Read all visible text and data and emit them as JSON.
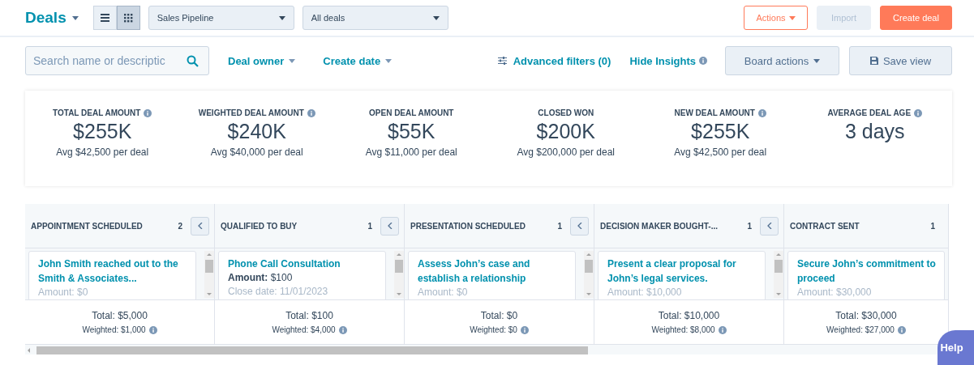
{
  "header": {
    "title": "Deals",
    "views": [
      {
        "kind": "list",
        "selected": false
      },
      {
        "kind": "grid",
        "selected": true
      }
    ],
    "pipeline": "Sales Pipeline",
    "filter": "All deals",
    "actions": "Actions",
    "import": {
      "label": "Import",
      "disabled": true
    },
    "create": "Create deal"
  },
  "filters": {
    "search_placeholder": "Search name or descriptic",
    "deal_owner": "Deal owner",
    "create_date": "Create date",
    "advanced": "Advanced filters (0)",
    "insights": "Hide Insights",
    "board_actions": "Board actions",
    "save_view": "Save view"
  },
  "metrics": [
    {
      "label": "TOTAL DEAL AMOUNT",
      "info": true,
      "value": "$255K",
      "sub": "Avg $42,500 per deal"
    },
    {
      "label": "WEIGHTED DEAL AMOUNT",
      "info": true,
      "value": "$240K",
      "sub": "Avg $40,000 per deal"
    },
    {
      "label": "OPEN DEAL AMOUNT",
      "info": false,
      "value": "$55K",
      "sub": "Avg $11,000 per deal"
    },
    {
      "label": "CLOSED WON",
      "info": false,
      "value": "$200K",
      "sub": "Avg $200,000 per deal"
    },
    {
      "label": "NEW DEAL AMOUNT",
      "info": true,
      "value": "$255K",
      "sub": "Avg $42,500 per deal"
    },
    {
      "label": "AVERAGE DEAL AGE",
      "info": true,
      "value": "3 days"
    }
  ],
  "stages": [
    {
      "name": "APPOINTMENT SCHEDULED",
      "count": "2",
      "collapse": true,
      "card": {
        "title": "John Smith reached out to the Smith & Associates...",
        "lines": [
          {
            "text": "Amount: $0",
            "faded": true
          }
        ]
      },
      "total": "Total: $5,000",
      "weighted": "Weighted: $1,000"
    },
    {
      "name": "QUALIFIED TO BUY",
      "count": "1",
      "collapse": true,
      "card": {
        "title": "Phone Call Consultation",
        "lines": [
          {
            "text": "**Amount:** $100",
            "faded": false
          },
          {
            "text": "Close date: 11/01/2023",
            "faded": true
          }
        ]
      },
      "total": "Total: $100",
      "weighted": "Weighted: $4,000"
    },
    {
      "name": "PRESENTATION SCHEDULED",
      "count": "1",
      "collapse": true,
      "card": {
        "title": "Assess John’s case and establish a relationship",
        "lines": [
          {
            "text": "Amount: $0",
            "faded": true
          }
        ]
      },
      "total": "Total: $0",
      "weighted": "Weighted: $0"
    },
    {
      "name": "DECISION MAKER BOUGHT-...",
      "count": "1",
      "collapse": true,
      "card": {
        "title": "Present a clear proposal for John’s legal services.",
        "lines": [
          {
            "text": "Amount: $10,000",
            "faded": true
          }
        ]
      },
      "total": "Total: $10,000",
      "weighted": "Weighted: $8,000"
    },
    {
      "name": "CONTRACT SENT",
      "count": "1",
      "collapse": false,
      "card": {
        "title": "Secure John’s commitment to proceed",
        "lines": [
          {
            "text": "Amount: $30,000",
            "faded": true
          }
        ]
      },
      "total": "Total: $30,000",
      "weighted": "Weighted: $27,000"
    }
  ],
  "help": "Help"
}
